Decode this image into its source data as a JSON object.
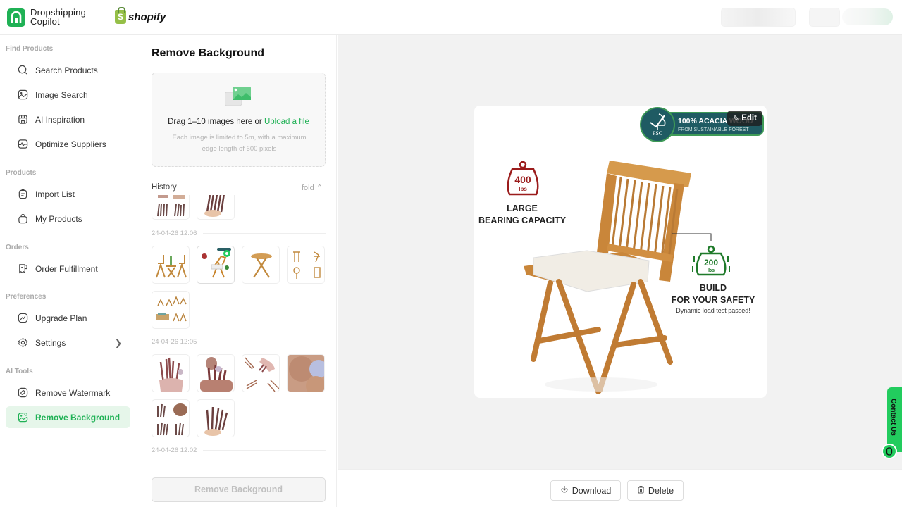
{
  "header": {
    "brand_line1": "Dropshipping",
    "brand_line2": "Copilot",
    "partner": "shopify"
  },
  "sidebar": {
    "sections": [
      {
        "title": "Find Products",
        "items": [
          {
            "label": "Search Products",
            "icon": "search-icon"
          },
          {
            "label": "Image Search",
            "icon": "image-search-icon"
          },
          {
            "label": "AI Inspiration",
            "icon": "store-icon"
          },
          {
            "label": "Optimize Suppliers",
            "icon": "pulse-icon"
          }
        ]
      },
      {
        "title": "Products",
        "items": [
          {
            "label": "Import List",
            "icon": "clipboard-icon"
          },
          {
            "label": "My Products",
            "icon": "bag-icon"
          }
        ]
      },
      {
        "title": "Orders",
        "items": [
          {
            "label": "Order Fulfillment",
            "icon": "receipt-icon"
          }
        ]
      },
      {
        "title": "Preferences",
        "items": [
          {
            "label": "Upgrade Plan",
            "icon": "trend-icon"
          },
          {
            "label": "Settings",
            "icon": "gear-icon",
            "has_submenu": true
          }
        ]
      },
      {
        "title": "AI Tools",
        "items": [
          {
            "label": "Remove Watermark",
            "icon": "eraser-icon"
          },
          {
            "label": "Remove Background",
            "icon": "remove-bg-icon",
            "active": true
          }
        ]
      }
    ]
  },
  "panel": {
    "title": "Remove Background",
    "dropzone": {
      "main_text": "Drag 1–10 images here or ",
      "link_text": "Upload a file",
      "sub_text": "Each image is limited to 5m, with a maximum edge length of 600 pixels"
    },
    "history": {
      "title": "History",
      "fold_label": "fold",
      "groups": [
        {
          "date": "",
          "thumbs": [
            "makeup-brushes-grid",
            "makeup-brushes-hand"
          ]
        },
        {
          "date": "24-04-26 12:06",
          "thumbs": [
            "bistro-set",
            "chair-with-badges",
            "folding-table",
            "furniture-views",
            "bistro-set-multi"
          ],
          "selected_index": 1
        },
        {
          "date": "24-04-26 12:05",
          "thumbs": [
            "brushes-in-pouch",
            "brushes-in-holder",
            "brushes-spread",
            "brush-closeup",
            "brushes-grid",
            "brushes-hand"
          ]
        },
        {
          "date": "24-04-26 12:02",
          "thumbs": []
        }
      ]
    },
    "action_button": "Remove Background"
  },
  "preview": {
    "edit_label": "Edit",
    "badge_title": "100% ACACIA WOOD",
    "badge_sub": "FROM SUSTAINABLE FOREST",
    "badge_logo": "FSC",
    "left_weight": "400",
    "left_unit": "lbs",
    "left_line1": "LARGE",
    "left_line2": "BEARING CAPACITY",
    "right_weight": "200",
    "right_unit": "lbs",
    "right_line1": "BUILD",
    "right_line2": "FOR YOUR SAFETY",
    "right_line3": "Dynamic load test passed!"
  },
  "footer": {
    "download_label": "Download",
    "delete_label": "Delete"
  },
  "contact": {
    "label": "Contact Us"
  },
  "colors": {
    "accent": "#1fb155",
    "active_bg": "#e6f6ea",
    "contact_green": "#22cc5e",
    "badge_teal": "#1f5b63",
    "weight_red": "#9b1c1c",
    "weight_green": "#1f7a2a"
  }
}
